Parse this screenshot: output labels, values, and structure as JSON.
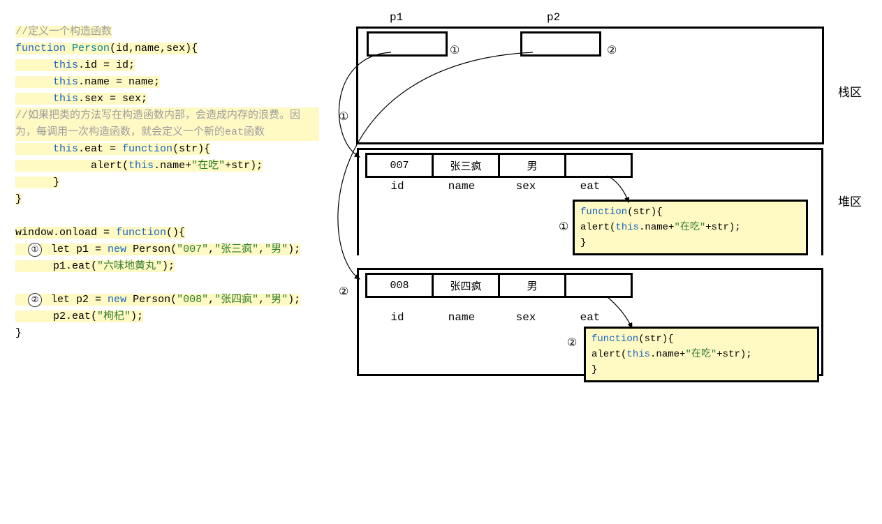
{
  "code": {
    "comment1": "//定义一个构造函数",
    "kw_function": "function",
    "fn_person": "Person",
    "params": "(id,name,sex){",
    "l_id": "this.id = id;",
    "l_name": "this.name = name;",
    "l_sex": "this.sex = sex;",
    "comment2": "//如果把类的方法写在构造函数内部，会造成内存的浪费。因为，每调用一次构造函数，就会定义一个新的eat函数",
    "l_eat": "this.eat = ",
    "kw_func2": "function",
    "l_eat_params": "(str){",
    "alert_pre": "alert(",
    "alert_this": "this",
    "alert_mid": ".name+",
    "str_eat": "\"在吃\"",
    "alert_suf": "+str);",
    "cb": "}",
    "onload_pre": "window.onload = ",
    "onload_fn": "function",
    "onload_suf": "(){",
    "let1_pre": "let p1 = ",
    "kw_new": "new",
    "let1_call": " Person(",
    "s007": "\"007\"",
    "s_zsf": "\"张三疯\"",
    "s_nan": "\"男\"",
    "let1_end": ");",
    "eat1_pre": "p1.eat(",
    "s_lwdhw": "\"六味地黄丸\"",
    "eat1_end": ");",
    "let2_pre": "let p2 = ",
    "let2_call": " Person(",
    "s008": "\"008\"",
    "s_zsif": "\"张四疯\"",
    "eat2_pre": "p2.eat(",
    "s_gq": "\"枸杞\"",
    "eat2_end": ");"
  },
  "diagram": {
    "p1": "p1",
    "p2": "p2",
    "m1": "①",
    "m2": "②",
    "stack_label": "栈区",
    "heap_label": "堆区",
    "obj1": {
      "id": "007",
      "name": "张三疯",
      "sex": "男",
      "eat": ""
    },
    "obj2": {
      "id": "008",
      "name": "张四疯",
      "sex": "男",
      "eat": ""
    },
    "fields": {
      "id": "id",
      "name": "name",
      "sex": "sex",
      "eat": "eat"
    },
    "func": {
      "l1_pre": "function",
      "l1_suf": "(str){",
      "l2_pre": "alert(",
      "l2_this": "this",
      "l2_mid": ".name+",
      "l2_str": "\"在吃\"",
      "l2_suf": "+str);",
      "l3": "}"
    }
  }
}
